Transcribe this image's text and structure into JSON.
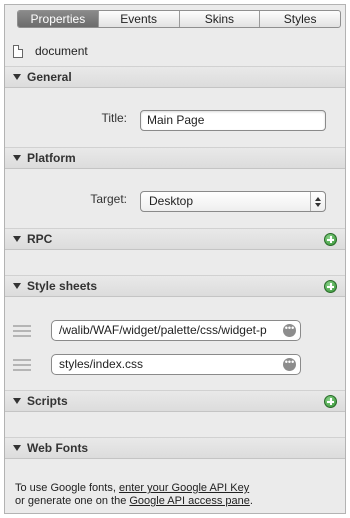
{
  "tabs": [
    {
      "label": "Properties",
      "active": true
    },
    {
      "label": "Events",
      "active": false
    },
    {
      "label": "Skins",
      "active": false
    },
    {
      "label": "Styles",
      "active": false
    }
  ],
  "document": {
    "label": "document"
  },
  "sections": {
    "general": "General",
    "platform": "Platform",
    "rpc": "RPC",
    "style_sheets": "Style sheets",
    "scripts": "Scripts",
    "web_fonts": "Web Fonts"
  },
  "general": {
    "title_label": "Title:",
    "title_value": "Main Page"
  },
  "platform": {
    "target_label": "Target:",
    "target_value": "Desktop"
  },
  "style_sheets": [
    "/walib/WAF/widget/palette/css/widget-p",
    "styles/index.css"
  ],
  "footer": {
    "line1_prefix": "To use Google fonts, ",
    "line1_link": "enter your Google API Key",
    "line2_prefix": "or generate one on the ",
    "line2_link": "Google API access pane",
    "line2_suffix": "."
  },
  "colors": {
    "accent_green": "#2f8f2f",
    "active_tab": "#7a7a7a"
  }
}
